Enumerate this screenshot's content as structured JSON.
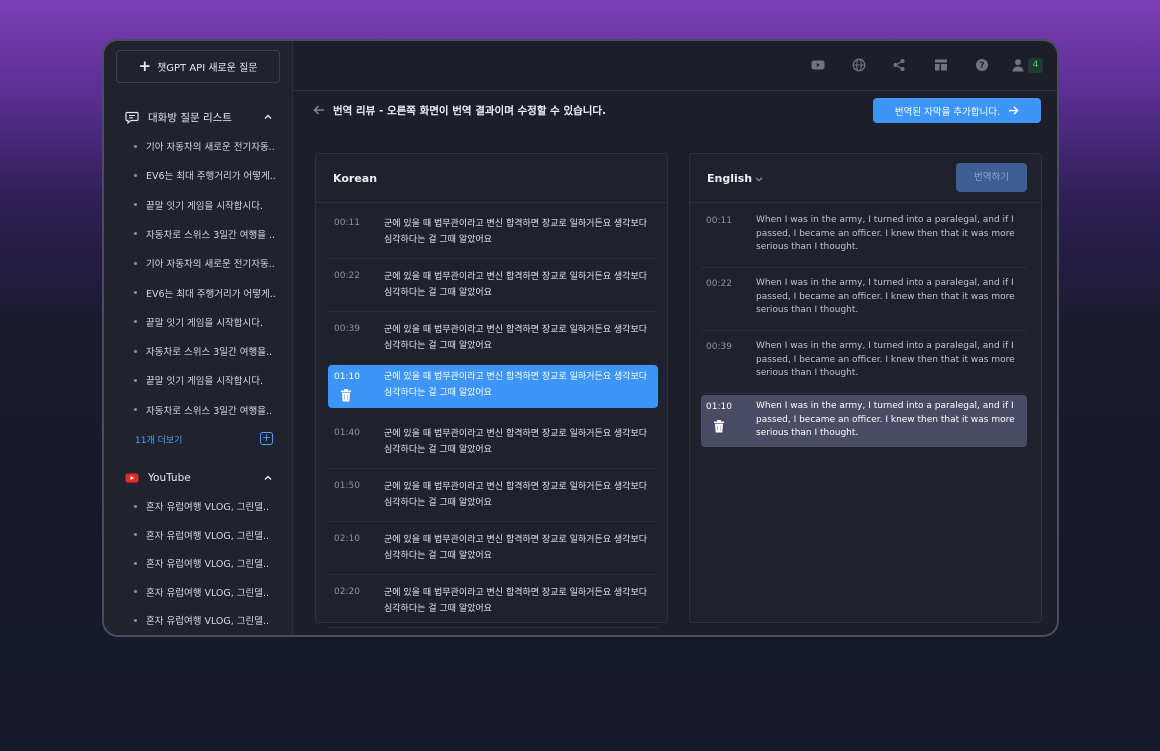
{
  "sidebar": {
    "new_button_label": "챗GPT API 새로운 질문",
    "chat_section_title": "대화방 질문 리스트",
    "chat_items": [
      "기아 자동차의 새로운 전기자동..",
      "EV6는 최대 주행거리가 어떻게..",
      "끝말 잇기 게임을 시작합시다.",
      "자동차로 스위스 3일간 여행을 ..",
      "기아 자동차의 새로운 전기자동..",
      "EV6는 최대 주행거리가 어떻게..",
      "끝말 잇기 게임을 시작합시다.",
      "자동차로 스위스 3일간 여행을..",
      "끝말 잇기 게임을 시작합시다.",
      "자동차로 스위스 3일간 여행을.."
    ],
    "more_label": "11개 더보기",
    "youtube_section_title": "YouTube",
    "youtube_items": [
      "혼자 유럽여행 VLOG, 그린델..",
      "혼자 유럽여행 VLOG, 그린델..",
      "혼자 유럽여행 VLOG, 그린델..",
      "혼자 유럽여행 VLOG, 그린델..",
      "혼자 유럽여행 VLOG, 그린델.."
    ]
  },
  "topbar": {
    "icons": [
      "youtube-icon",
      "globe-icon",
      "share-icon",
      "layout-icon",
      "help-icon",
      "user-icon"
    ],
    "user_badge": "4"
  },
  "subbar": {
    "title": "번역 리뷰 - 오른쪽 화면이 번역 결과이며 수정할 수 있습니다.",
    "add_button_label": "번역된 자막을 추가합니다."
  },
  "left_panel": {
    "language": "Korean",
    "rows": [
      {
        "time": "00:11",
        "text": "군에 있을 때 법무관이라고 변신 합격하면 장교로 일하거든요 생각보다 심각하다는 걸 그때 알았어요"
      },
      {
        "time": "00:22",
        "text": "군에 있을 때 법무관이라고 변신 합격하면 장교로 일하거든요 생각보다 심각하다는 걸 그때 알았어요"
      },
      {
        "time": "00:39",
        "text": "군에 있을 때 법무관이라고 변신 합격하면 장교로 일하거든요 생각보다 심각하다는 걸 그때 알았어요"
      },
      {
        "time": "01:10",
        "text": "군에 있을 때 법무관이라고 변신 합격하면 장교로 일하거든요 생각보다 심각하다는 걸 그때 알았어요"
      },
      {
        "time": "01:40",
        "text": "군에 있을 때 법무관이라고 변신 합격하면 장교로 일하거든요 생각보다 심각하다는 걸 그때 알았어요"
      },
      {
        "time": "01:50",
        "text": "군에 있을 때 법무관이라고 변신 합격하면 장교로 일하거든요 생각보다 심각하다는 걸 그때 알았어요"
      },
      {
        "time": "02:10",
        "text": "군에 있을 때 법무관이라고 변신 합격하면 장교로 일하거든요 생각보다 심각하다는 걸 그때 알았어요"
      },
      {
        "time": "02:20",
        "text": "군에 있을 때 법무관이라고 변신 합격하면 장교로 일하거든요 생각보다 심각하다는 걸 그때 알았어요"
      }
    ]
  },
  "right_panel": {
    "language": "English",
    "translate_button_label": "번역하기",
    "rows": [
      {
        "time": "00:11",
        "text": "When I was in the army, I turned into a paralegal, and if I passed, I became an officer. I knew then that it was more serious than I thought."
      },
      {
        "time": "00:22",
        "text": "When I was in the army, I turned into a paralegal, and if I passed, I became an officer. I knew then that it was more serious than I thought."
      },
      {
        "time": "00:39",
        "text": "When I was in the army, I turned into a paralegal, and if I passed, I became an officer. I knew then that it was more serious than I thought."
      },
      {
        "time": "01:10",
        "text": "When I was in the army, I turned into a paralegal, and if I passed, I became an officer. I knew then that it was more serious than I thought."
      }
    ]
  },
  "colors": {
    "accent": "#3d96f7",
    "selected_left": "#3d96f7",
    "selected_right": "#4a4c66",
    "badge_green": "#48d17a"
  }
}
